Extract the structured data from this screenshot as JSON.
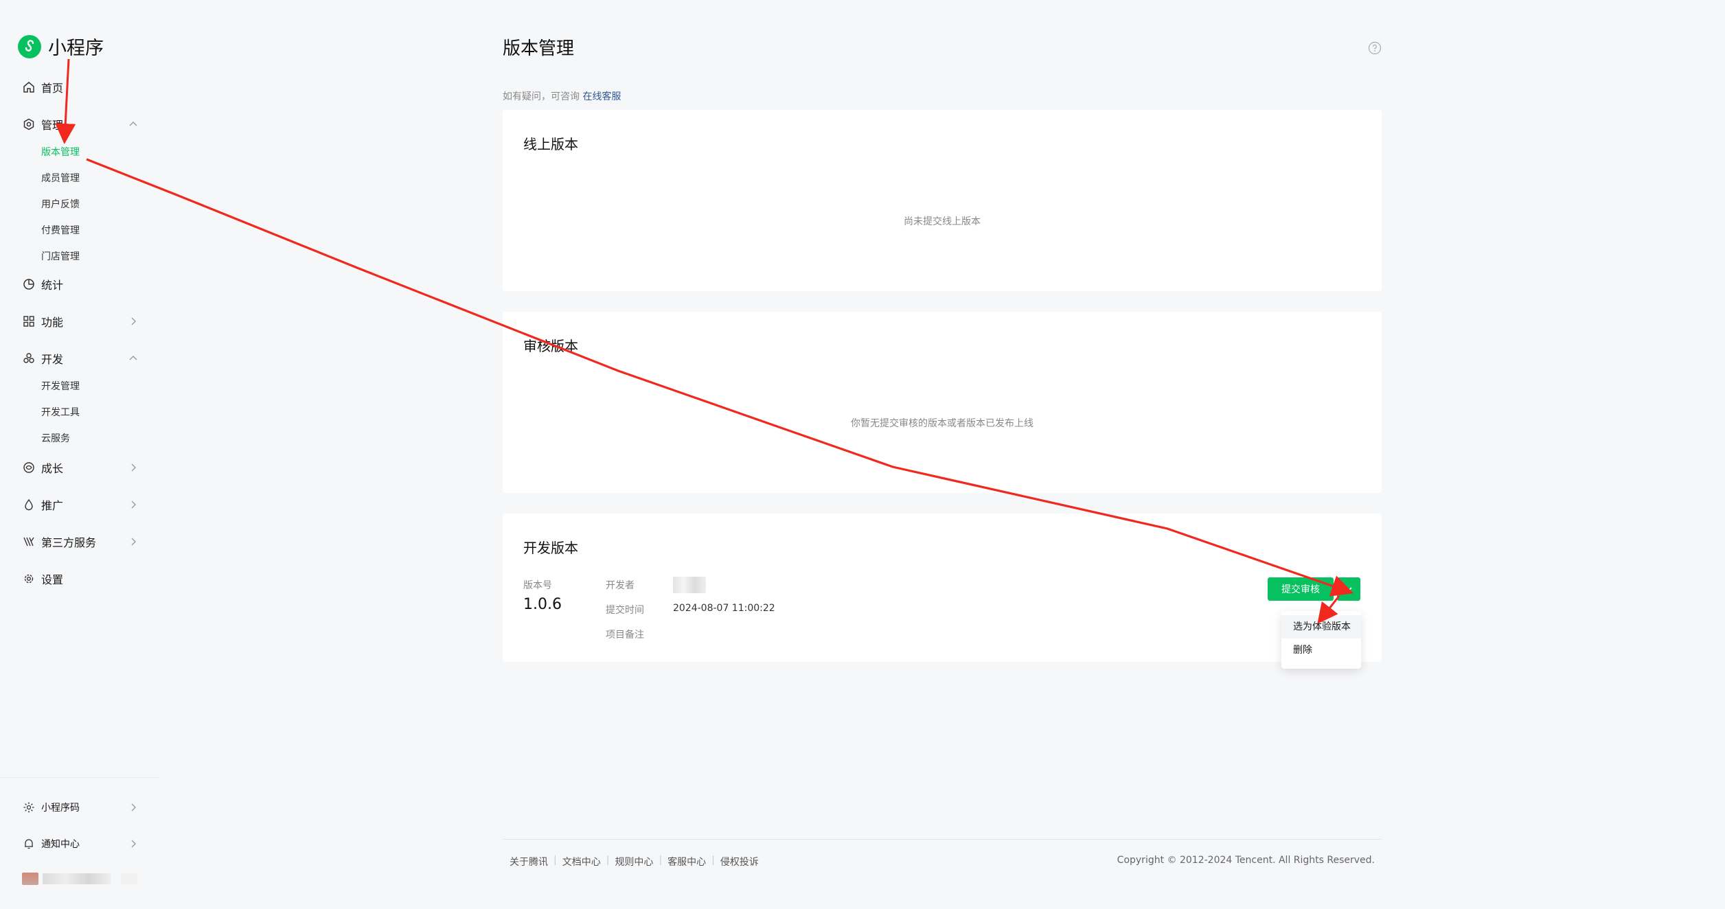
{
  "app": {
    "name": "小程序",
    "brand_color": "#07c160"
  },
  "sidebar": {
    "items": [
      {
        "label": "首页",
        "icon": "home-icon"
      },
      {
        "label": "管理",
        "icon": "gear-outline-icon",
        "expanded": true,
        "children": [
          "版本管理",
          "成员管理",
          "用户反馈",
          "付费管理",
          "门店管理"
        ],
        "active_child": "版本管理"
      },
      {
        "label": "统计",
        "icon": "pie-chart-icon"
      },
      {
        "label": "功能",
        "icon": "grid-icon"
      },
      {
        "label": "开发",
        "icon": "dev-icon",
        "expanded": true,
        "children": [
          "开发管理",
          "开发工具",
          "云服务"
        ]
      },
      {
        "label": "成长",
        "icon": "growth-icon"
      },
      {
        "label": "推广",
        "icon": "promote-icon"
      },
      {
        "label": "第三方服务",
        "icon": "thirdparty-icon"
      },
      {
        "label": "设置",
        "icon": "settings-icon"
      }
    ],
    "bottom": [
      {
        "label": "小程序码",
        "icon": "qrcode-icon"
      },
      {
        "label": "通知中心",
        "icon": "bell-icon"
      }
    ]
  },
  "page": {
    "title": "版本管理",
    "hint_prefix": "如有疑问，可咨询",
    "hint_link": "在线客服"
  },
  "online": {
    "title": "线上版本",
    "empty": "尚未提交线上版本"
  },
  "review": {
    "title": "审核版本",
    "empty": "你暂无提交审核的版本或者版本已发布上线"
  },
  "dev": {
    "title": "开发版本",
    "version_label": "版本号",
    "version": "1.0.6",
    "developer_label": "开发者",
    "submit_time_label": "提交时间",
    "submit_time": "2024-08-07 11:00:22",
    "remark_label": "项目备注",
    "submit_button": "提交审核",
    "menu": [
      "选为体验版本",
      "删除"
    ]
  },
  "footer": {
    "links": [
      "关于腾讯",
      "文档中心",
      "规则中心",
      "客服中心",
      "侵权投诉"
    ],
    "copyright": "Copyright © 2012-2024 Tencent. All Rights Reserved."
  }
}
